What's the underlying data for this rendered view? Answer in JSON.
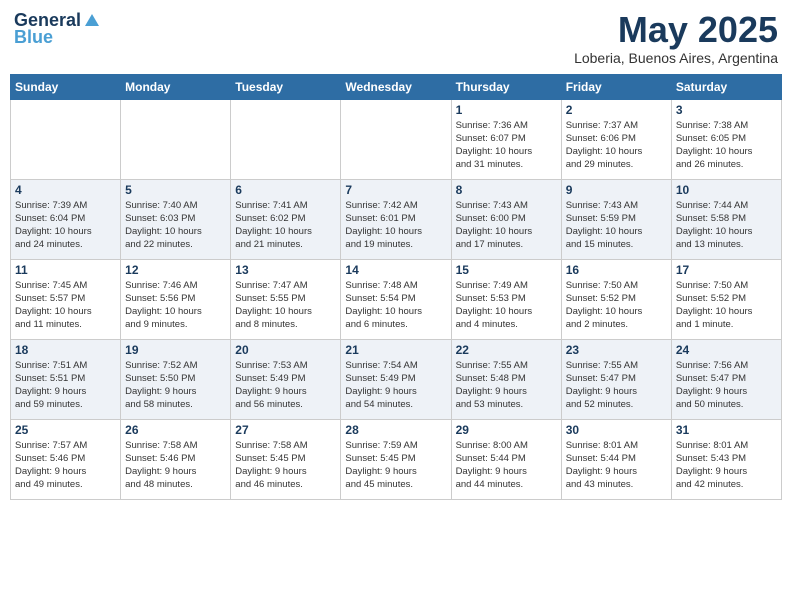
{
  "header": {
    "logo_line1": "General",
    "logo_line2": "Blue",
    "main_title": "May 2025",
    "subtitle": "Loberia, Buenos Aires, Argentina"
  },
  "calendar": {
    "days_of_week": [
      "Sunday",
      "Monday",
      "Tuesday",
      "Wednesday",
      "Thursday",
      "Friday",
      "Saturday"
    ],
    "weeks": [
      [
        {
          "day": "",
          "info": ""
        },
        {
          "day": "",
          "info": ""
        },
        {
          "day": "",
          "info": ""
        },
        {
          "day": "",
          "info": ""
        },
        {
          "day": "1",
          "info": "Sunrise: 7:36 AM\nSunset: 6:07 PM\nDaylight: 10 hours\nand 31 minutes."
        },
        {
          "day": "2",
          "info": "Sunrise: 7:37 AM\nSunset: 6:06 PM\nDaylight: 10 hours\nand 29 minutes."
        },
        {
          "day": "3",
          "info": "Sunrise: 7:38 AM\nSunset: 6:05 PM\nDaylight: 10 hours\nand 26 minutes."
        }
      ],
      [
        {
          "day": "4",
          "info": "Sunrise: 7:39 AM\nSunset: 6:04 PM\nDaylight: 10 hours\nand 24 minutes."
        },
        {
          "day": "5",
          "info": "Sunrise: 7:40 AM\nSunset: 6:03 PM\nDaylight: 10 hours\nand 22 minutes."
        },
        {
          "day": "6",
          "info": "Sunrise: 7:41 AM\nSunset: 6:02 PM\nDaylight: 10 hours\nand 21 minutes."
        },
        {
          "day": "7",
          "info": "Sunrise: 7:42 AM\nSunset: 6:01 PM\nDaylight: 10 hours\nand 19 minutes."
        },
        {
          "day": "8",
          "info": "Sunrise: 7:43 AM\nSunset: 6:00 PM\nDaylight: 10 hours\nand 17 minutes."
        },
        {
          "day": "9",
          "info": "Sunrise: 7:43 AM\nSunset: 5:59 PM\nDaylight: 10 hours\nand 15 minutes."
        },
        {
          "day": "10",
          "info": "Sunrise: 7:44 AM\nSunset: 5:58 PM\nDaylight: 10 hours\nand 13 minutes."
        }
      ],
      [
        {
          "day": "11",
          "info": "Sunrise: 7:45 AM\nSunset: 5:57 PM\nDaylight: 10 hours\nand 11 minutes."
        },
        {
          "day": "12",
          "info": "Sunrise: 7:46 AM\nSunset: 5:56 PM\nDaylight: 10 hours\nand 9 minutes."
        },
        {
          "day": "13",
          "info": "Sunrise: 7:47 AM\nSunset: 5:55 PM\nDaylight: 10 hours\nand 8 minutes."
        },
        {
          "day": "14",
          "info": "Sunrise: 7:48 AM\nSunset: 5:54 PM\nDaylight: 10 hours\nand 6 minutes."
        },
        {
          "day": "15",
          "info": "Sunrise: 7:49 AM\nSunset: 5:53 PM\nDaylight: 10 hours\nand 4 minutes."
        },
        {
          "day": "16",
          "info": "Sunrise: 7:50 AM\nSunset: 5:52 PM\nDaylight: 10 hours\nand 2 minutes."
        },
        {
          "day": "17",
          "info": "Sunrise: 7:50 AM\nSunset: 5:52 PM\nDaylight: 10 hours\nand 1 minute."
        }
      ],
      [
        {
          "day": "18",
          "info": "Sunrise: 7:51 AM\nSunset: 5:51 PM\nDaylight: 9 hours\nand 59 minutes."
        },
        {
          "day": "19",
          "info": "Sunrise: 7:52 AM\nSunset: 5:50 PM\nDaylight: 9 hours\nand 58 minutes."
        },
        {
          "day": "20",
          "info": "Sunrise: 7:53 AM\nSunset: 5:49 PM\nDaylight: 9 hours\nand 56 minutes."
        },
        {
          "day": "21",
          "info": "Sunrise: 7:54 AM\nSunset: 5:49 PM\nDaylight: 9 hours\nand 54 minutes."
        },
        {
          "day": "22",
          "info": "Sunrise: 7:55 AM\nSunset: 5:48 PM\nDaylight: 9 hours\nand 53 minutes."
        },
        {
          "day": "23",
          "info": "Sunrise: 7:55 AM\nSunset: 5:47 PM\nDaylight: 9 hours\nand 52 minutes."
        },
        {
          "day": "24",
          "info": "Sunrise: 7:56 AM\nSunset: 5:47 PM\nDaylight: 9 hours\nand 50 minutes."
        }
      ],
      [
        {
          "day": "25",
          "info": "Sunrise: 7:57 AM\nSunset: 5:46 PM\nDaylight: 9 hours\nand 49 minutes."
        },
        {
          "day": "26",
          "info": "Sunrise: 7:58 AM\nSunset: 5:46 PM\nDaylight: 9 hours\nand 48 minutes."
        },
        {
          "day": "27",
          "info": "Sunrise: 7:58 AM\nSunset: 5:45 PM\nDaylight: 9 hours\nand 46 minutes."
        },
        {
          "day": "28",
          "info": "Sunrise: 7:59 AM\nSunset: 5:45 PM\nDaylight: 9 hours\nand 45 minutes."
        },
        {
          "day": "29",
          "info": "Sunrise: 8:00 AM\nSunset: 5:44 PM\nDaylight: 9 hours\nand 44 minutes."
        },
        {
          "day": "30",
          "info": "Sunrise: 8:01 AM\nSunset: 5:44 PM\nDaylight: 9 hours\nand 43 minutes."
        },
        {
          "day": "31",
          "info": "Sunrise: 8:01 AM\nSunset: 5:43 PM\nDaylight: 9 hours\nand 42 minutes."
        }
      ]
    ]
  }
}
